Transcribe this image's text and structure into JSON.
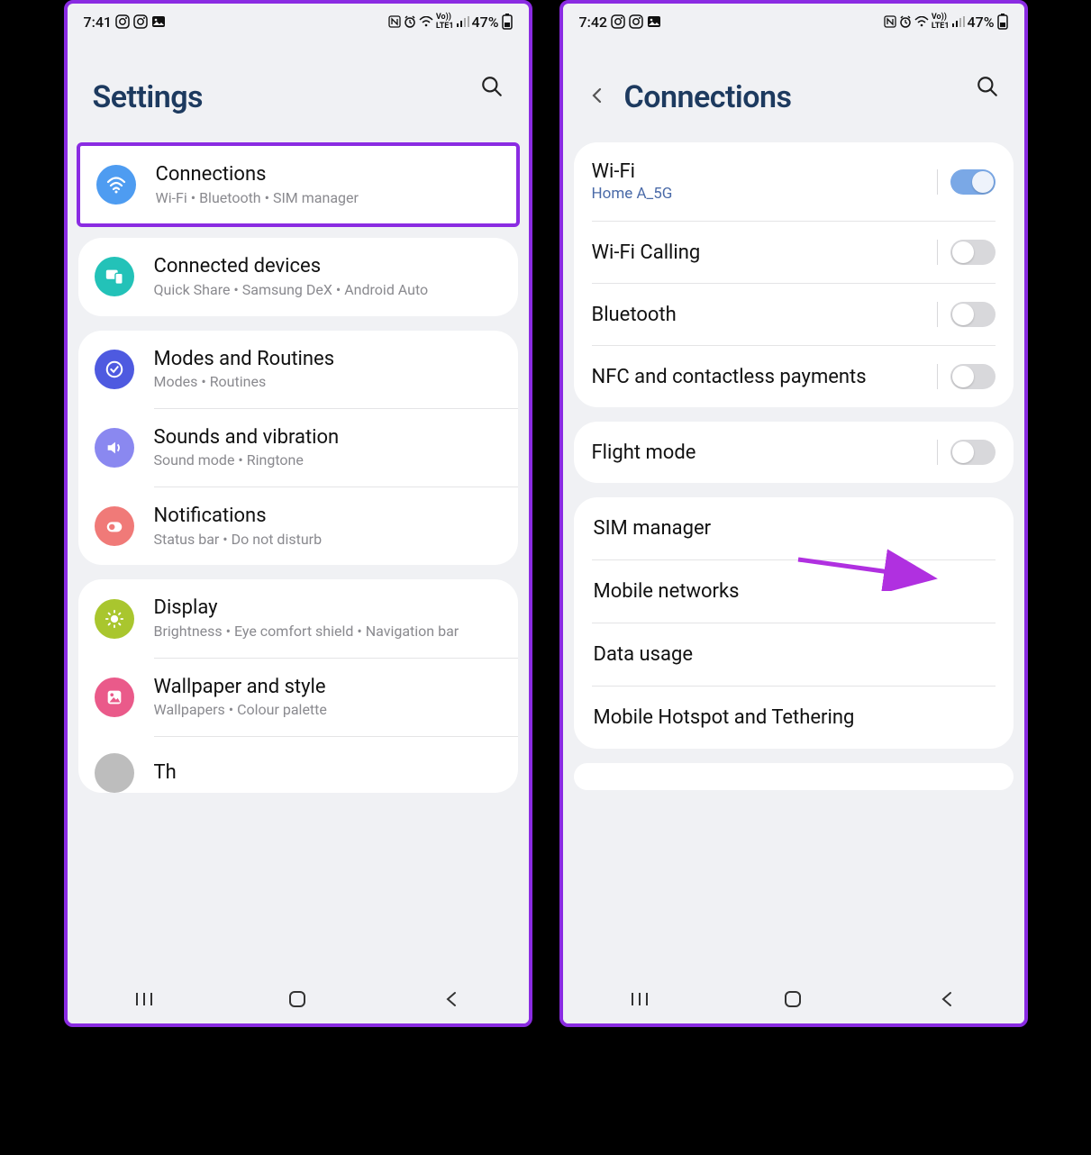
{
  "left": {
    "status": {
      "time": "7:41",
      "battery": "47%"
    },
    "title": "Settings",
    "groups": [
      [
        {
          "icon": "wifi",
          "color": "c-blue",
          "title": "Connections",
          "sub": "Wi-Fi  •  Bluetooth  •  SIM manager",
          "highlight": true
        },
        {
          "icon": "devices",
          "color": "c-teal",
          "title": "Connected devices",
          "sub": "Quick Share  •  Samsung DeX  •  Android Auto"
        }
      ],
      [
        {
          "icon": "modes",
          "color": "c-indigo",
          "title": "Modes and Routines",
          "sub": "Modes  •  Routines"
        },
        {
          "icon": "sound",
          "color": "c-violet",
          "title": "Sounds and vibration",
          "sub": "Sound mode  •  Ringtone"
        },
        {
          "icon": "notif",
          "color": "c-coral",
          "title": "Notifications",
          "sub": "Status bar  •  Do not disturb"
        }
      ],
      [
        {
          "icon": "display",
          "color": "c-lime",
          "title": "Display",
          "sub": "Brightness  •  Eye comfort shield  •  Navigation bar"
        },
        {
          "icon": "wallpaper",
          "color": "c-pink",
          "title": "Wallpaper and style",
          "sub": "Wallpapers  •  Colour palette"
        },
        {
          "icon": "themes",
          "color": "c-grey",
          "title": "Th",
          "sub": ""
        }
      ]
    ]
  },
  "right": {
    "status": {
      "time": "7:42",
      "battery": "47%"
    },
    "title": "Connections",
    "group1": [
      {
        "title": "Wi-Fi",
        "sub": "Home A_5G",
        "on": true
      },
      {
        "title": "Wi-Fi Calling",
        "on": false
      },
      {
        "title": "Bluetooth",
        "on": false
      },
      {
        "title": "NFC and contactless payments",
        "on": false
      }
    ],
    "group2": [
      {
        "title": "Flight mode",
        "on": false
      }
    ],
    "group3": [
      {
        "title": "SIM manager"
      },
      {
        "title": "Mobile networks"
      },
      {
        "title": "Data usage"
      },
      {
        "title": "Mobile Hotspot and Tethering"
      }
    ]
  }
}
